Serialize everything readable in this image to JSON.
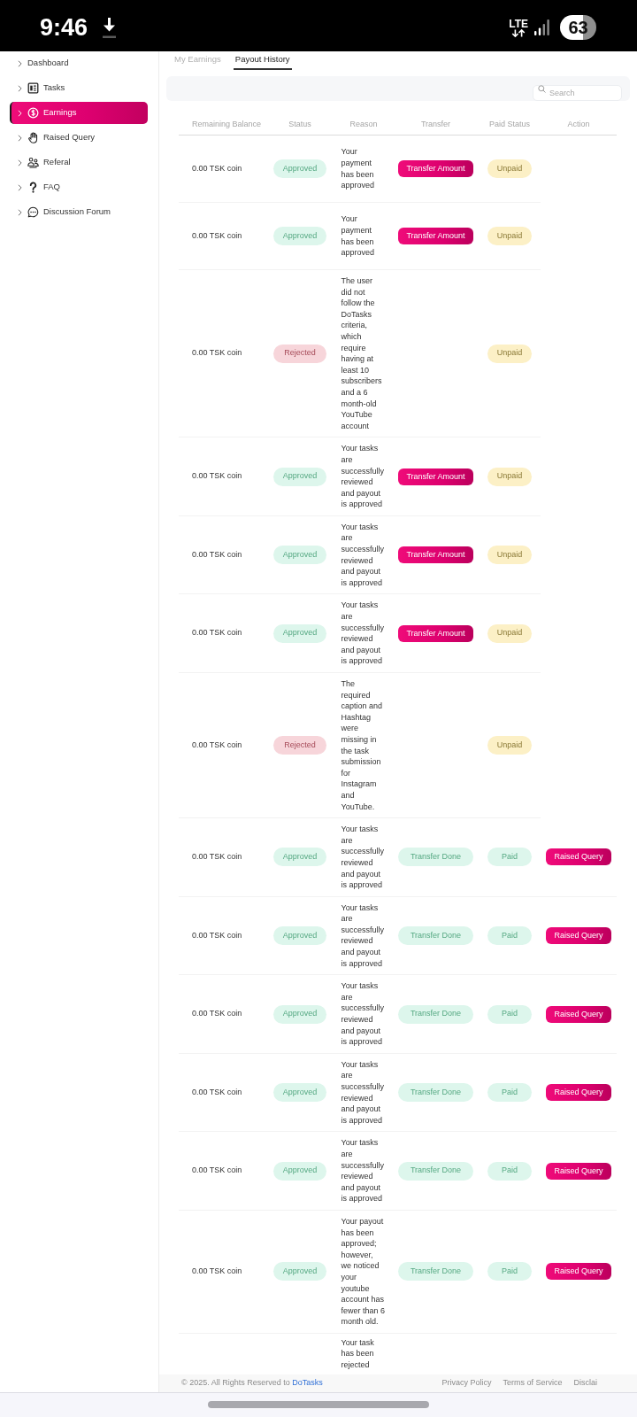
{
  "status_bar": {
    "time": "9:46",
    "network": "LTE",
    "battery": "63"
  },
  "sidebar": {
    "items": [
      {
        "label": "Dashboard",
        "selected": false
      },
      {
        "label": "Tasks",
        "selected": false
      },
      {
        "label": "Earnings",
        "selected": true
      },
      {
        "label": "Raised Query",
        "selected": false
      },
      {
        "label": "Referal",
        "selected": false
      },
      {
        "label": "FAQ",
        "selected": false
      },
      {
        "label": "Discussion Forum",
        "selected": false
      }
    ]
  },
  "tabs": [
    {
      "label": "My Earnings",
      "selected": false
    },
    {
      "label": "Payout History",
      "selected": true
    }
  ],
  "search": {
    "placeholder": "Search"
  },
  "table": {
    "columns": [
      "Remaining Balance",
      "Status",
      "Reason",
      "Transfer",
      "Paid Status",
      "Action"
    ],
    "rows": [
      {
        "balance": "0.00 TSK coin",
        "status": {
          "text": "Approved",
          "kind": "approved"
        },
        "reason": "Your payment has been approved",
        "transfer": {
          "text": "Transfer Amount",
          "kind": "button"
        },
        "paid_status": {
          "text": "Unpaid",
          "kind": "unpaid"
        }
      },
      {
        "balance": "0.00 TSK coin",
        "status": {
          "text": "Approved",
          "kind": "approved"
        },
        "reason": "Your payment has been approved",
        "transfer": {
          "text": "Transfer Amount",
          "kind": "button"
        },
        "paid_status": {
          "text": "Unpaid",
          "kind": "unpaid"
        }
      },
      {
        "balance": "0.00 TSK coin",
        "status": {
          "text": "Rejected",
          "kind": "rejected"
        },
        "reason": "The user did not follow the DoTasks criteria, which require having at least 10 subscribers and a 6 month-old YouTube account",
        "paid_status": {
          "text": "Unpaid",
          "kind": "unpaid"
        }
      },
      {
        "balance": "0.00 TSK coin",
        "status": {
          "text": "Approved",
          "kind": "approved"
        },
        "reason": "Your tasks are successfully reviewed and payout is approved",
        "transfer": {
          "text": "Transfer Amount",
          "kind": "button"
        },
        "paid_status": {
          "text": "Unpaid",
          "kind": "unpaid"
        }
      },
      {
        "balance": "0.00 TSK coin",
        "status": {
          "text": "Approved",
          "kind": "approved"
        },
        "reason": "Your tasks are successfully reviewed and payout is approved",
        "transfer": {
          "text": "Transfer Amount",
          "kind": "button"
        },
        "paid_status": {
          "text": "Unpaid",
          "kind": "unpaid"
        }
      },
      {
        "balance": "0.00 TSK coin",
        "status": {
          "text": "Approved",
          "kind": "approved"
        },
        "reason": "Your tasks are successfully reviewed and payout is approved",
        "transfer": {
          "text": "Transfer Amount",
          "kind": "button"
        },
        "paid_status": {
          "text": "Unpaid",
          "kind": "unpaid"
        }
      },
      {
        "balance": "0.00 TSK coin",
        "status": {
          "text": "Rejected",
          "kind": "rejected"
        },
        "reason": "The required caption and Hashtag were missing in the task submission for Instagram and YouTube.",
        "paid_status": {
          "text": "Unpaid",
          "kind": "unpaid"
        }
      },
      {
        "balance": "0.00 TSK coin",
        "status": {
          "text": "Approved",
          "kind": "approved"
        },
        "reason": "Your tasks are successfully reviewed and payout is approved",
        "transfer": {
          "text": "Transfer Done",
          "kind": "done"
        },
        "paid_status": {
          "text": "Paid",
          "kind": "paid"
        },
        "action": "Raised Query"
      },
      {
        "balance": "0.00 TSK coin",
        "status": {
          "text": "Approved",
          "kind": "approved"
        },
        "reason": "Your tasks are successfully reviewed and payout is approved",
        "transfer": {
          "text": "Transfer Done",
          "kind": "done"
        },
        "paid_status": {
          "text": "Paid",
          "kind": "paid"
        },
        "action": "Raised Query"
      },
      {
        "balance": "0.00 TSK coin",
        "status": {
          "text": "Approved",
          "kind": "approved"
        },
        "reason": "Your tasks are successfully reviewed and payout is approved",
        "transfer": {
          "text": "Transfer Done",
          "kind": "done"
        },
        "paid_status": {
          "text": "Paid",
          "kind": "paid"
        },
        "action": "Raised Query"
      },
      {
        "balance": "0.00 TSK coin",
        "status": {
          "text": "Approved",
          "kind": "approved"
        },
        "reason": "Your tasks are successfully reviewed and payout is approved",
        "transfer": {
          "text": "Transfer Done",
          "kind": "done"
        },
        "paid_status": {
          "text": "Paid",
          "kind": "paid"
        },
        "action": "Raised Query"
      },
      {
        "balance": "0.00 TSK coin",
        "status": {
          "text": "Approved",
          "kind": "approved"
        },
        "reason": "Your tasks are successfully reviewed and payout is approved",
        "transfer": {
          "text": "Transfer Done",
          "kind": "done"
        },
        "paid_status": {
          "text": "Paid",
          "kind": "paid"
        },
        "action": "Raised Query"
      },
      {
        "balance": "0.00 TSK coin",
        "status": {
          "text": "Approved",
          "kind": "approved"
        },
        "reason": "Your payout has been approved; however, we noticed your youtube account has fewer than 6 month old.",
        "transfer": {
          "text": "Transfer Done",
          "kind": "done"
        },
        "paid_status": {
          "text": "Paid",
          "kind": "paid"
        },
        "action": "Raised Query"
      },
      {
        "reason": "Your task has been rejected"
      }
    ]
  },
  "footer": {
    "copyright": "© 2025. All Rights Reserved to",
    "brand": "DoTasks",
    "links": [
      "Privacy Policy",
      "Terms of Service",
      "Disclai"
    ]
  }
}
